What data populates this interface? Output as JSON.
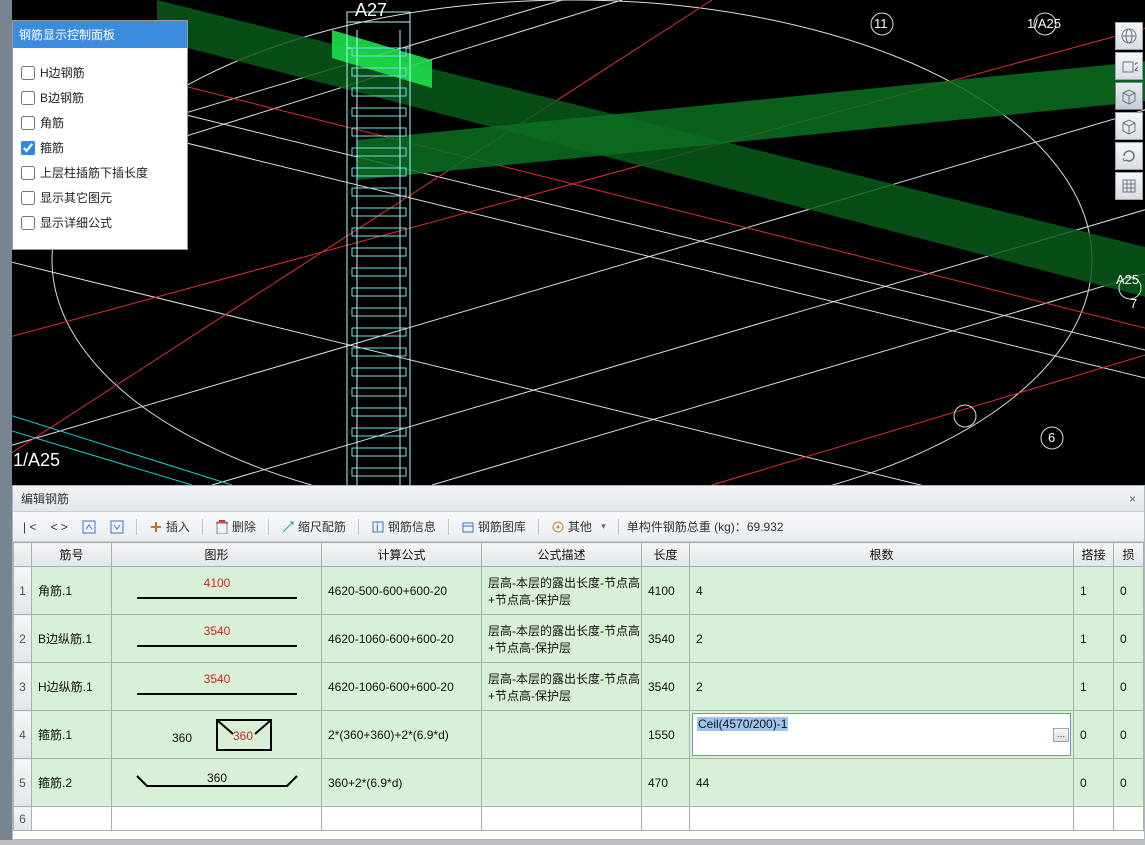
{
  "panel": {
    "title": "钢筋显示控制面板",
    "items": [
      {
        "label": "H边钢筋",
        "checked": false
      },
      {
        "label": "B边钢筋",
        "checked": false
      },
      {
        "label": "角筋",
        "checked": false
      },
      {
        "label": "箍筋",
        "checked": true
      },
      {
        "label": "上层柱插筋下插长度",
        "checked": false
      },
      {
        "label": "显示其它图元",
        "checked": false
      },
      {
        "label": "显示详细公式",
        "checked": false
      }
    ]
  },
  "viewport_labels": {
    "a27": "A27",
    "eleven": "11",
    "a25_top": "1/A25",
    "a25_right": "A25",
    "seven": "7",
    "six": "6",
    "a25_bottom": "1/A25"
  },
  "right_tools": [
    {
      "name": "globe-icon"
    },
    {
      "name": "cube-20-icon",
      "badge": "20"
    },
    {
      "name": "cube-icon",
      "active": true
    },
    {
      "name": "cube-wire-icon"
    },
    {
      "name": "refresh-icon"
    },
    {
      "name": "grid-icon"
    }
  ],
  "lower": {
    "title": "编辑钢筋",
    "close": "×"
  },
  "toolbar": {
    "nav1": "| <",
    "nav2": "< >",
    "insert": "插入",
    "delete": "删除",
    "scale": "缩尺配筋",
    "info": "钢筋信息",
    "lib": "钢筋图库",
    "other": "其他",
    "other_caret": "▾",
    "total_label": "单构件钢筋总重 (kg)：",
    "total_value": "69.932"
  },
  "columns": {
    "jh": "筋号",
    "tx": "图形",
    "gs": "计算公式",
    "ms": "公式描述",
    "cd": "长度",
    "gs2": "根数",
    "dj": "搭接",
    "sun": "损"
  },
  "rows": [
    {
      "n": "1",
      "jh": "角筋.1",
      "dim": "4100",
      "dim_red": true,
      "shape": "line",
      "gs": "4620-500-600+600-20",
      "ms": "层高-本层的露出长度-节点高+节点高-保护层",
      "cd": "4100",
      "gs2": "4",
      "dj": "1",
      "sun": "0"
    },
    {
      "n": "2",
      "jh": "B边纵筋.1",
      "dim": "3540",
      "dim_red": true,
      "shape": "line",
      "gs": "4620-1060-600+600-20",
      "ms": "层高-本层的露出长度-节点高+节点高-保护层",
      "cd": "3540",
      "gs2": "2",
      "dj": "1",
      "sun": "0"
    },
    {
      "n": "3",
      "jh": "H边纵筋.1",
      "dim": "3540",
      "dim_red": true,
      "shape": "line",
      "gs": "4620-1060-600+600-20",
      "ms": "层高-本层的露出长度-节点高+节点高-保护层",
      "cd": "3540",
      "gs2": "2",
      "dj": "1",
      "sun": "0"
    },
    {
      "n": "4",
      "jh": "箍筋.1",
      "dim": "360",
      "dim2": "360",
      "dim2_red": true,
      "shape": "stirrup",
      "gs": "2*(360+360)+2*(6.9*d)",
      "ms": "",
      "cd": "1550",
      "gs2_edit": "Ceil(4570/200)-1",
      "dj": "0",
      "sun": "0"
    },
    {
      "n": "5",
      "jh": "箍筋.2",
      "dim": "360",
      "shape": "hook",
      "gs": "360+2*(6.9*d)",
      "ms": "",
      "cd": "470",
      "gs2": "44",
      "dj": "0",
      "sun": "0"
    }
  ],
  "blank_row": "6"
}
